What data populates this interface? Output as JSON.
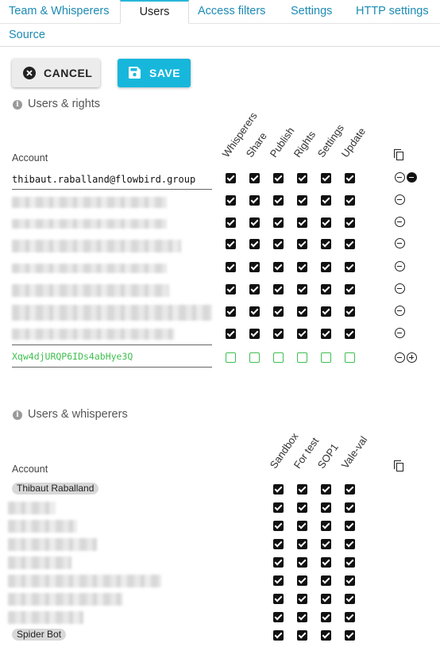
{
  "tabs": [
    {
      "label": "Team & Whisperers",
      "active": false
    },
    {
      "label": "Users",
      "active": true
    },
    {
      "label": "Access filters",
      "active": false
    },
    {
      "label": "Settings",
      "active": false
    },
    {
      "label": "HTTP settings",
      "active": false
    },
    {
      "label": "Source",
      "active": false
    }
  ],
  "buttons": {
    "cancel": "CANCEL",
    "save": "SAVE"
  },
  "rights_section": {
    "title": "Users & rights",
    "account_label": "Account",
    "columns": [
      "Whisperers",
      "Share",
      "Publish",
      "Rights",
      "Settings",
      "Update"
    ],
    "first_user": "thibaut.raballand@flowbird.group",
    "new_user_value": "Xqw4djURQP6IDs4abHye3Q"
  },
  "whisperers_section": {
    "title": "Users & whisperers",
    "account_label": "Account",
    "columns": [
      "Sandbox",
      "For test",
      "SOP1",
      "Vale-val"
    ],
    "first_user": "Thibaut Raballand",
    "last_user": "Spider Bot"
  }
}
